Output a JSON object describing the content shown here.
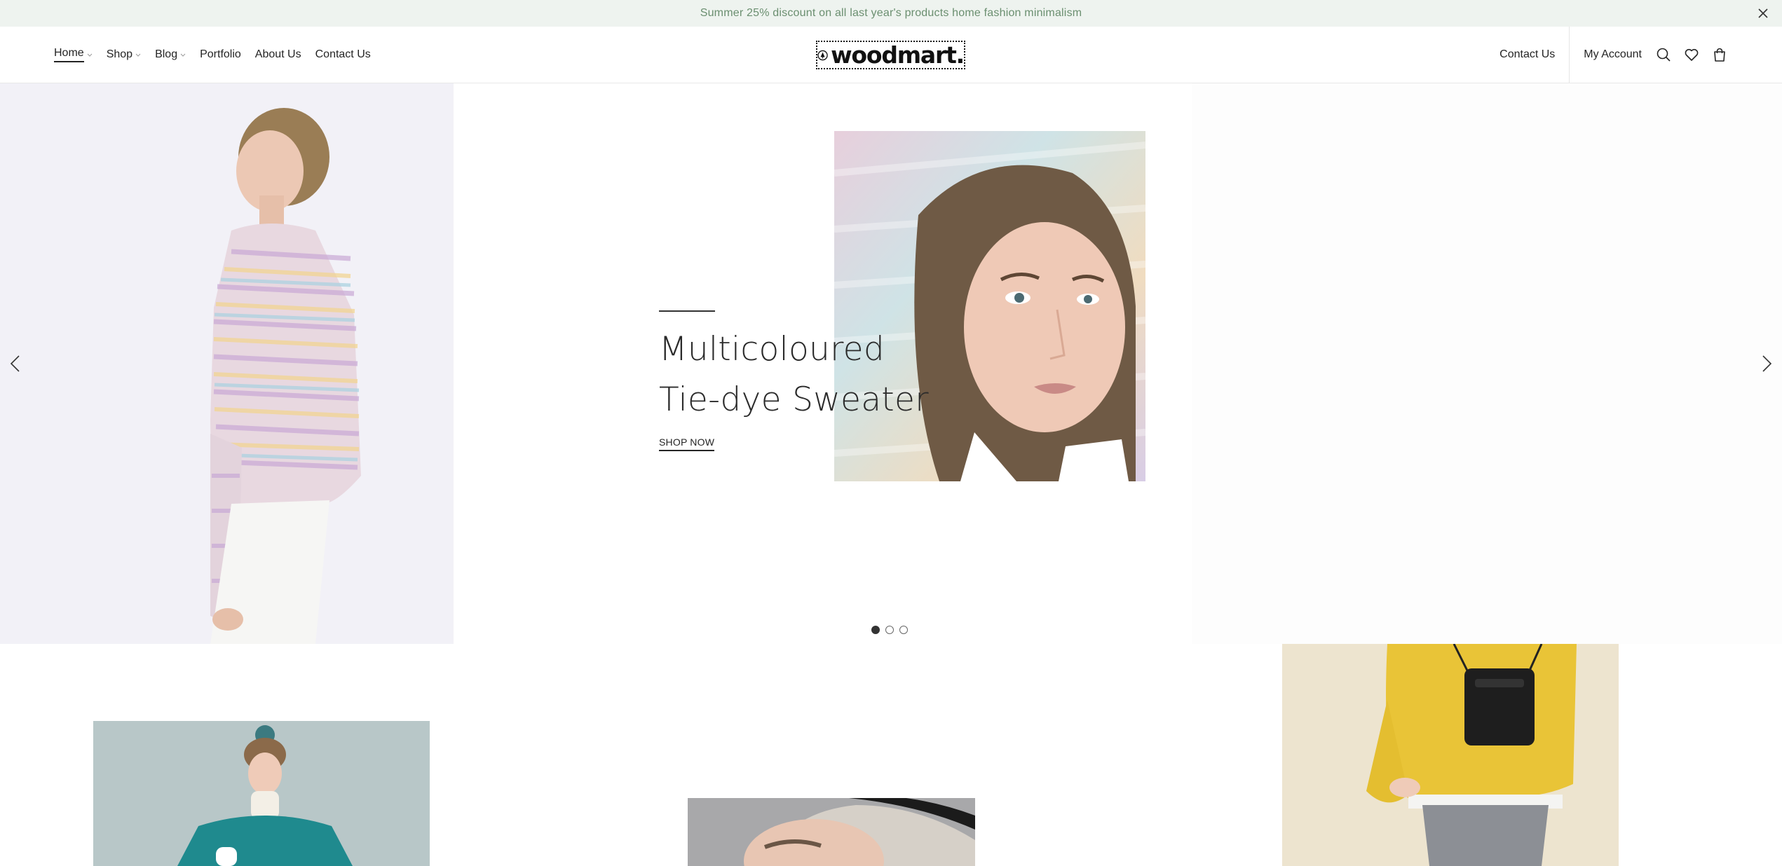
{
  "promo": {
    "text": "Summer 25% discount on all last year's products home fashion minimalism",
    "close_icon": "close-icon"
  },
  "header": {
    "nav": [
      {
        "label": "Home",
        "has_dropdown": true,
        "active": true
      },
      {
        "label": "Shop",
        "has_dropdown": true
      },
      {
        "label": "Blog",
        "has_dropdown": true
      },
      {
        "label": "Portfolio",
        "has_dropdown": false
      },
      {
        "label": "About Us",
        "has_dropdown": false
      },
      {
        "label": "Contact Us",
        "has_dropdown": false
      }
    ],
    "logo_text": "woodmart.",
    "contact_label": "Contact Us",
    "account_label": "My Account",
    "icons": [
      "search-icon",
      "heart-icon",
      "cart-icon"
    ]
  },
  "hero": {
    "title_line1": "Multicoloured",
    "title_line2": "Tie-dye Sweater",
    "cta_label": "SHOP NOW",
    "slide_count": 3,
    "active_slide": 1
  },
  "colors": {
    "promo_bg": "#eef3ef",
    "promo_text": "#6b8f70",
    "hero_left_bg": "#f2f1f7",
    "text": "#242424"
  }
}
